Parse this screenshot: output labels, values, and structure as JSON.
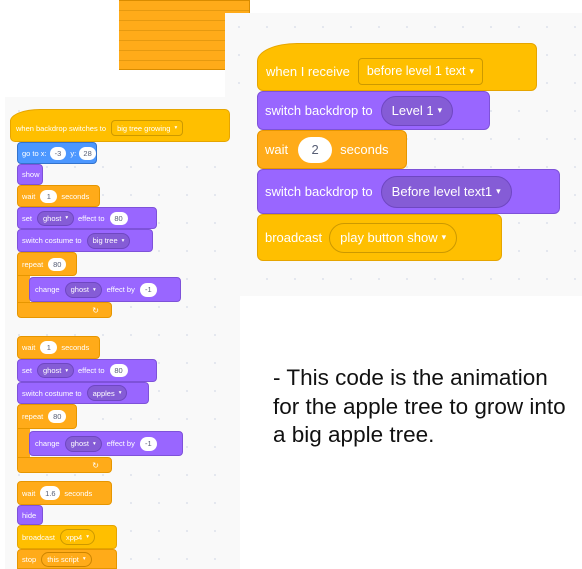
{
  "right_script": {
    "hat": {
      "label": "when I receive",
      "value": "before level 1 text"
    },
    "b1": {
      "label": "switch backdrop to",
      "value": "Level 1"
    },
    "b2": {
      "label": "wait",
      "value": "2",
      "unit": "seconds"
    },
    "b3": {
      "label": "switch backdrop to",
      "value": "Before level text1"
    },
    "b4": {
      "label": "broadcast",
      "value": "play button show"
    }
  },
  "left_script": {
    "hat": {
      "label": "when backdrop switches to",
      "value": "big tree growing"
    },
    "goto": {
      "label": "go to x:",
      "x": "-3",
      "ylabel": "y:",
      "y": "28"
    },
    "show": "show",
    "wait1": {
      "label": "wait",
      "value": "1",
      "unit": "seconds"
    },
    "set1": {
      "label": "set",
      "effect": "ghost",
      "label2": "effect to",
      "value": "80"
    },
    "costume1": {
      "label": "switch costume to",
      "value": "big tree"
    },
    "repeat1": {
      "label": "repeat",
      "value": "80"
    },
    "change1": {
      "label": "change",
      "effect": "ghost",
      "label2": "effect by",
      "value": "-1"
    },
    "wait2": {
      "label": "wait",
      "value": "1",
      "unit": "seconds"
    },
    "set2": {
      "label": "set",
      "effect": "ghost",
      "label2": "effect to",
      "value": "80"
    },
    "costume2": {
      "label": "switch costume to",
      "value": "apples"
    },
    "repeat2": {
      "label": "repeat",
      "value": "80"
    },
    "change2": {
      "label": "change",
      "effect": "ghost",
      "label2": "effect by",
      "value": "-1"
    },
    "wait3": {
      "label": "wait",
      "value": "1.6",
      "unit": "seconds"
    },
    "hide": "hide",
    "broadcast": {
      "label": "broadcast",
      "value": "xpp4"
    },
    "stop": {
      "label": "stop",
      "value": "this script"
    }
  },
  "note": "- This code is the animation for the apple tree to grow into a big apple tree.",
  "icons": {
    "dropdown": "▾",
    "loop": "↻"
  },
  "colors": {
    "events": "#ffbf00",
    "control": "#ffab19",
    "looks": "#9966ff",
    "motion": "#4c97ff"
  }
}
